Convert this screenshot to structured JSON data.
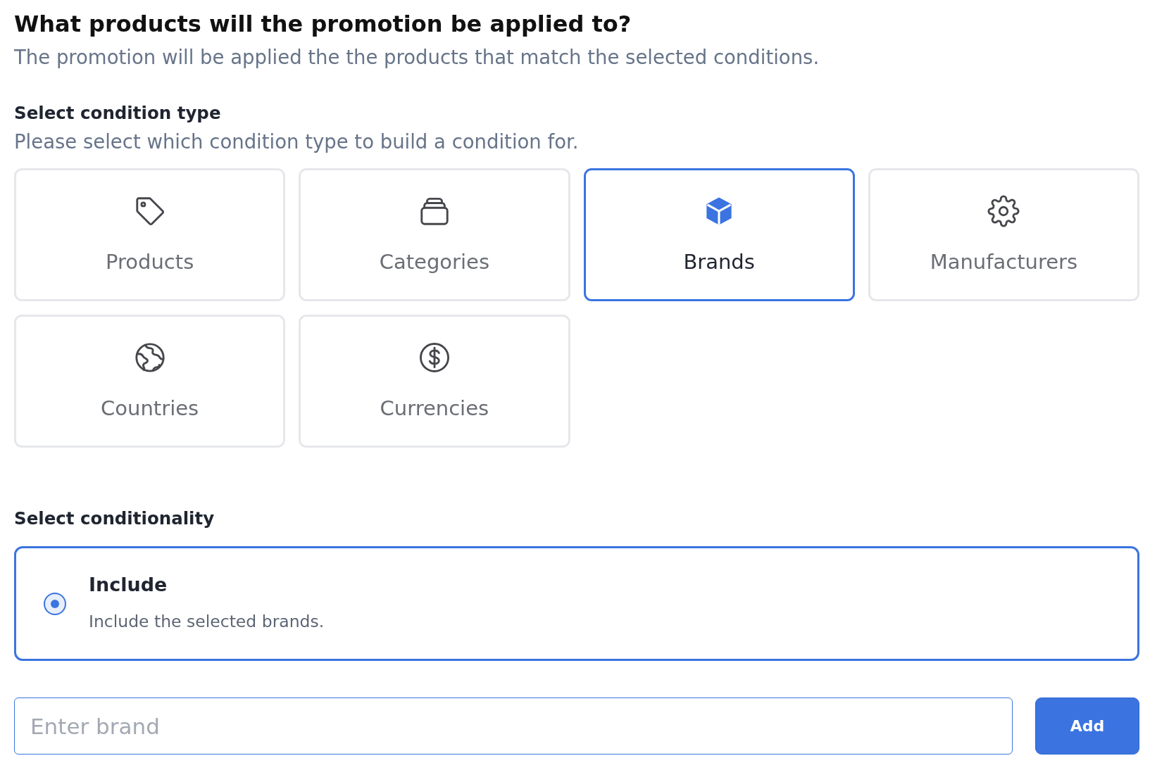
{
  "heading": {
    "title": "What products will the promotion be applied to?",
    "subtitle": "The promotion will be applied the the products that match the selected conditions."
  },
  "condition_type": {
    "label": "Select condition type",
    "hint": "Please select which condition type to build a condition for.",
    "options": [
      {
        "label": "Products",
        "kind": "tag",
        "selected": false
      },
      {
        "label": "Categories",
        "kind": "stack",
        "selected": false
      },
      {
        "label": "Brands",
        "kind": "cube",
        "selected": true
      },
      {
        "label": "Manufacturers",
        "kind": "gear",
        "selected": false
      },
      {
        "label": "Countries",
        "kind": "globe",
        "selected": false
      },
      {
        "label": "Currencies",
        "kind": "dollar",
        "selected": false
      }
    ]
  },
  "conditionality": {
    "label": "Select conditionality",
    "options": [
      {
        "title": "Include",
        "description": "Include the selected brands.",
        "selected": true
      }
    ]
  },
  "entry": {
    "placeholder": "Enter brand",
    "button": "Add"
  }
}
